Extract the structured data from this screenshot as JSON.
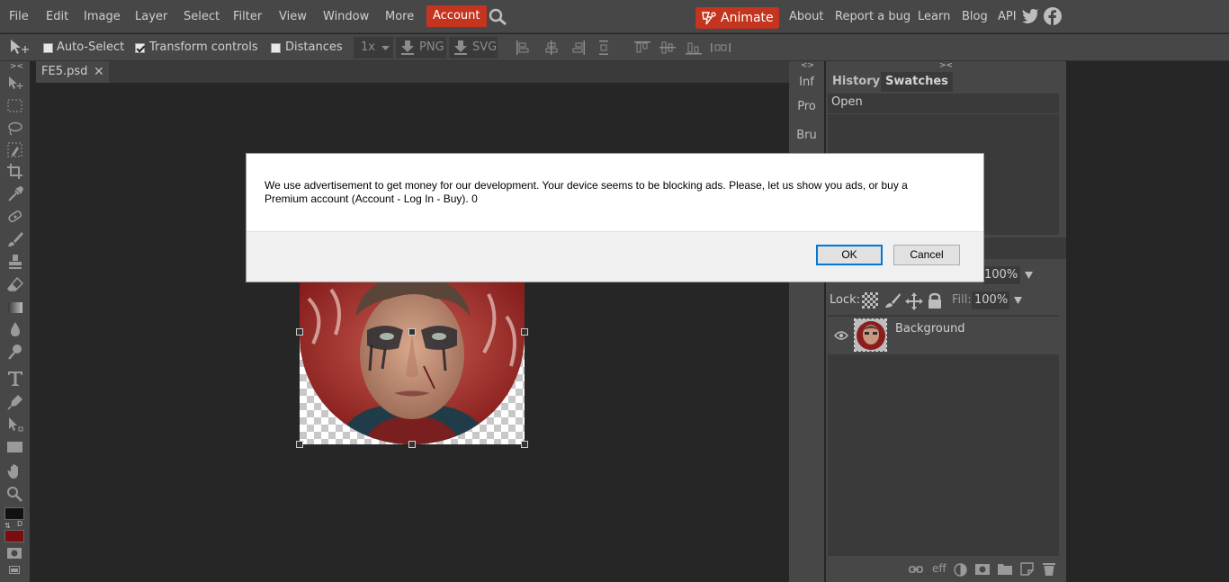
{
  "menu": {
    "items": [
      "File",
      "Edit",
      "Image",
      "Layer",
      "Select",
      "Filter",
      "View",
      "Window",
      "More"
    ],
    "account": "Account",
    "animate": "Animate",
    "right_links": [
      "About",
      "Report a bug",
      "Learn",
      "Blog",
      "API"
    ]
  },
  "options": {
    "auto_select": "Auto-Select",
    "transform_controls": "Transform controls",
    "distances": "Distances",
    "zoom": "1x",
    "png": "PNG",
    "svg": "SVG"
  },
  "document": {
    "tab_title": "FE5.psd"
  },
  "mini_panel": {
    "items": [
      "Inf",
      "Pro",
      "Bru"
    ]
  },
  "right_panel": {
    "tabs": [
      "History",
      "Swatches"
    ],
    "history_items": [
      "Open"
    ],
    "opacity_value": "100%",
    "lock_label": "Lock:",
    "fill_label": "Fill:",
    "fill_value": "100%",
    "layer_name": "Background",
    "footer_eff": "eff"
  },
  "dialog": {
    "message": "We use advertisement to get money for our development. Your device seems to be blocking ads. Please, let us show you ads, or buy a Premium account (Account - Log In - Buy).  0",
    "ok": "OK",
    "cancel": "Cancel"
  },
  "colors": {
    "accent": "#c4341f",
    "foreground_swatch": "#111111",
    "background_swatch": "#7a0e0e",
    "panel_bg": "#474747",
    "workspace_bg": "#262626"
  }
}
